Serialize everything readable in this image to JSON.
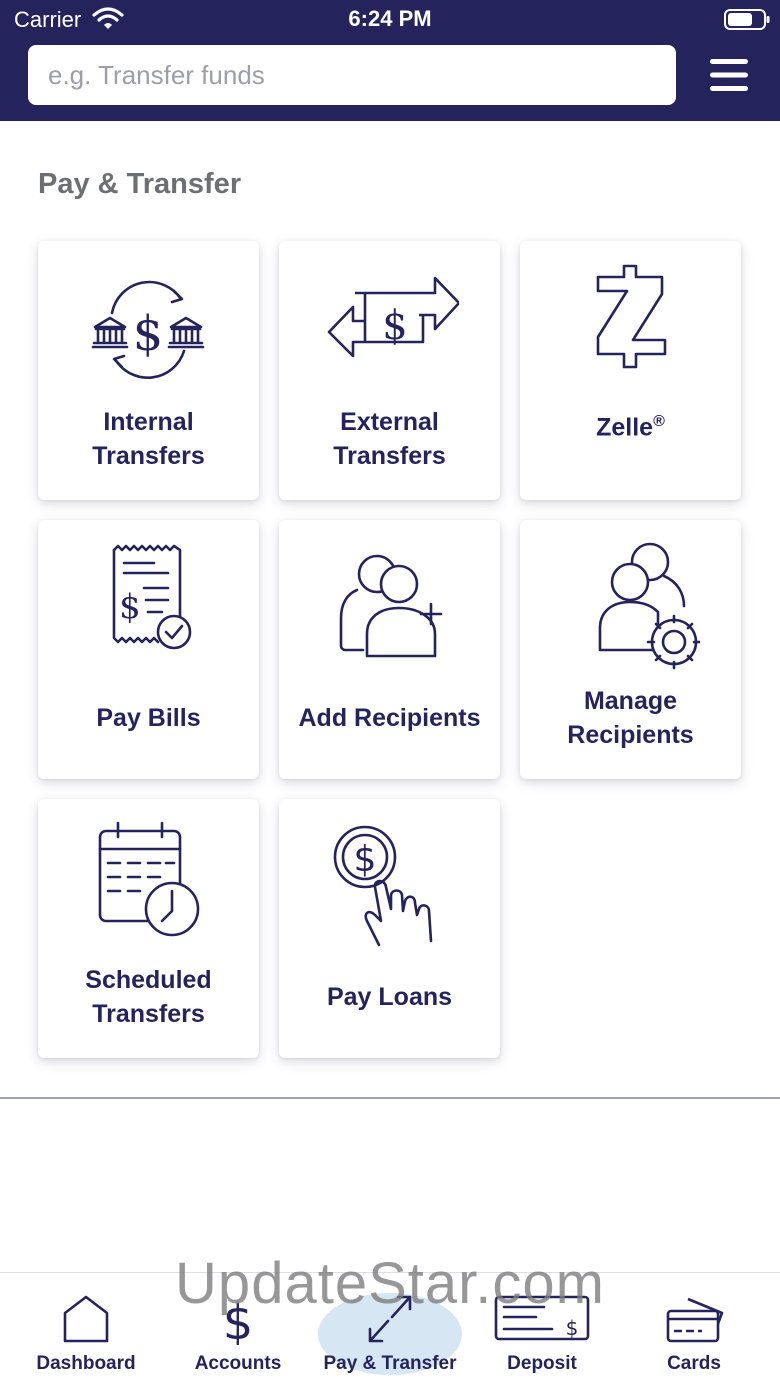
{
  "status_bar": {
    "carrier": "Carrier",
    "time": "6:24 PM"
  },
  "search": {
    "placeholder": "e.g. Transfer funds"
  },
  "section_title": "Pay & Transfer",
  "tiles": [
    {
      "label_line1": "Internal",
      "label_line2": "Transfers",
      "icon": "internal-transfer-icon"
    },
    {
      "label_line1": "External",
      "label_line2": "Transfers",
      "icon": "external-transfer-icon"
    },
    {
      "label": "Zelle",
      "label_mark": "®",
      "icon": "zelle-icon"
    },
    {
      "label": "Pay Bills",
      "icon": "bill-icon"
    },
    {
      "label": "Add Recipients",
      "icon": "add-user-icon"
    },
    {
      "label_line1": "Manage",
      "label_line2": "Recipients",
      "icon": "manage-users-icon"
    },
    {
      "label_line1": "Scheduled",
      "label_line2": "Transfers",
      "icon": "calendar-clock-icon"
    },
    {
      "label": "Pay Loans",
      "icon": "loan-payment-icon"
    }
  ],
  "tabbar": {
    "items": [
      {
        "label": "Dashboard",
        "icon": "home-icon"
      },
      {
        "label": "Accounts",
        "icon": "dollar-icon"
      },
      {
        "label": "Pay & Transfer",
        "icon": "transfer-arrows-icon",
        "active": true
      },
      {
        "label": "Deposit",
        "icon": "check-deposit-icon"
      },
      {
        "label": "Cards",
        "icon": "cards-icon"
      }
    ]
  },
  "watermark": "UpdateStar.com",
  "colors": {
    "brand": "#25235c",
    "active_tab_bg": "#d6e6f3",
    "section_title": "#6e6f73"
  }
}
